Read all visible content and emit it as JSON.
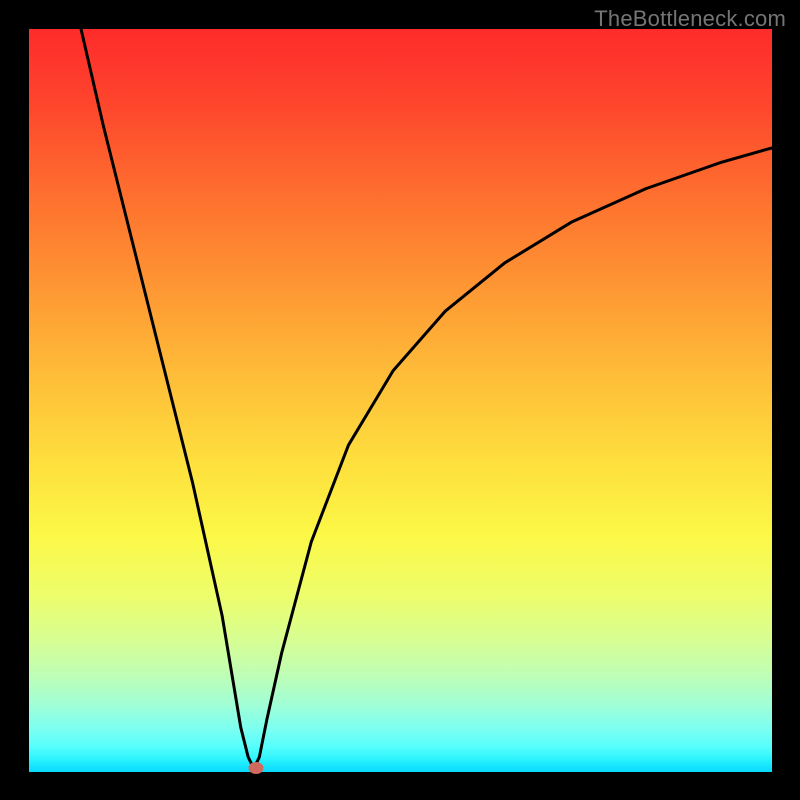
{
  "watermark": "TheBottleneck.com",
  "chart_data": {
    "type": "line",
    "title": "",
    "xlabel": "",
    "ylabel": "",
    "xlim": [
      0,
      100
    ],
    "ylim": [
      0,
      100
    ],
    "grid": false,
    "series": [
      {
        "name": "curve",
        "x": [
          7,
          10,
          14,
          18,
          22,
          26,
          27.5,
          28.5,
          29.5,
          30.25,
          31,
          32,
          34,
          38,
          43,
          49,
          56,
          64,
          73,
          83,
          93,
          100
        ],
        "values": [
          100,
          87,
          71,
          55,
          39,
          21,
          12,
          6,
          2,
          0.5,
          2,
          7,
          16,
          31,
          44,
          54,
          62,
          68.5,
          74,
          78.5,
          82,
          84
        ]
      }
    ],
    "marker": {
      "x": 30.5,
      "y": 0.5
    },
    "colors": {
      "curve": "#000000",
      "marker": "#d06a5e",
      "gradient_top": "#fe2b2b",
      "gradient_bottom": "#09d8fe"
    }
  }
}
